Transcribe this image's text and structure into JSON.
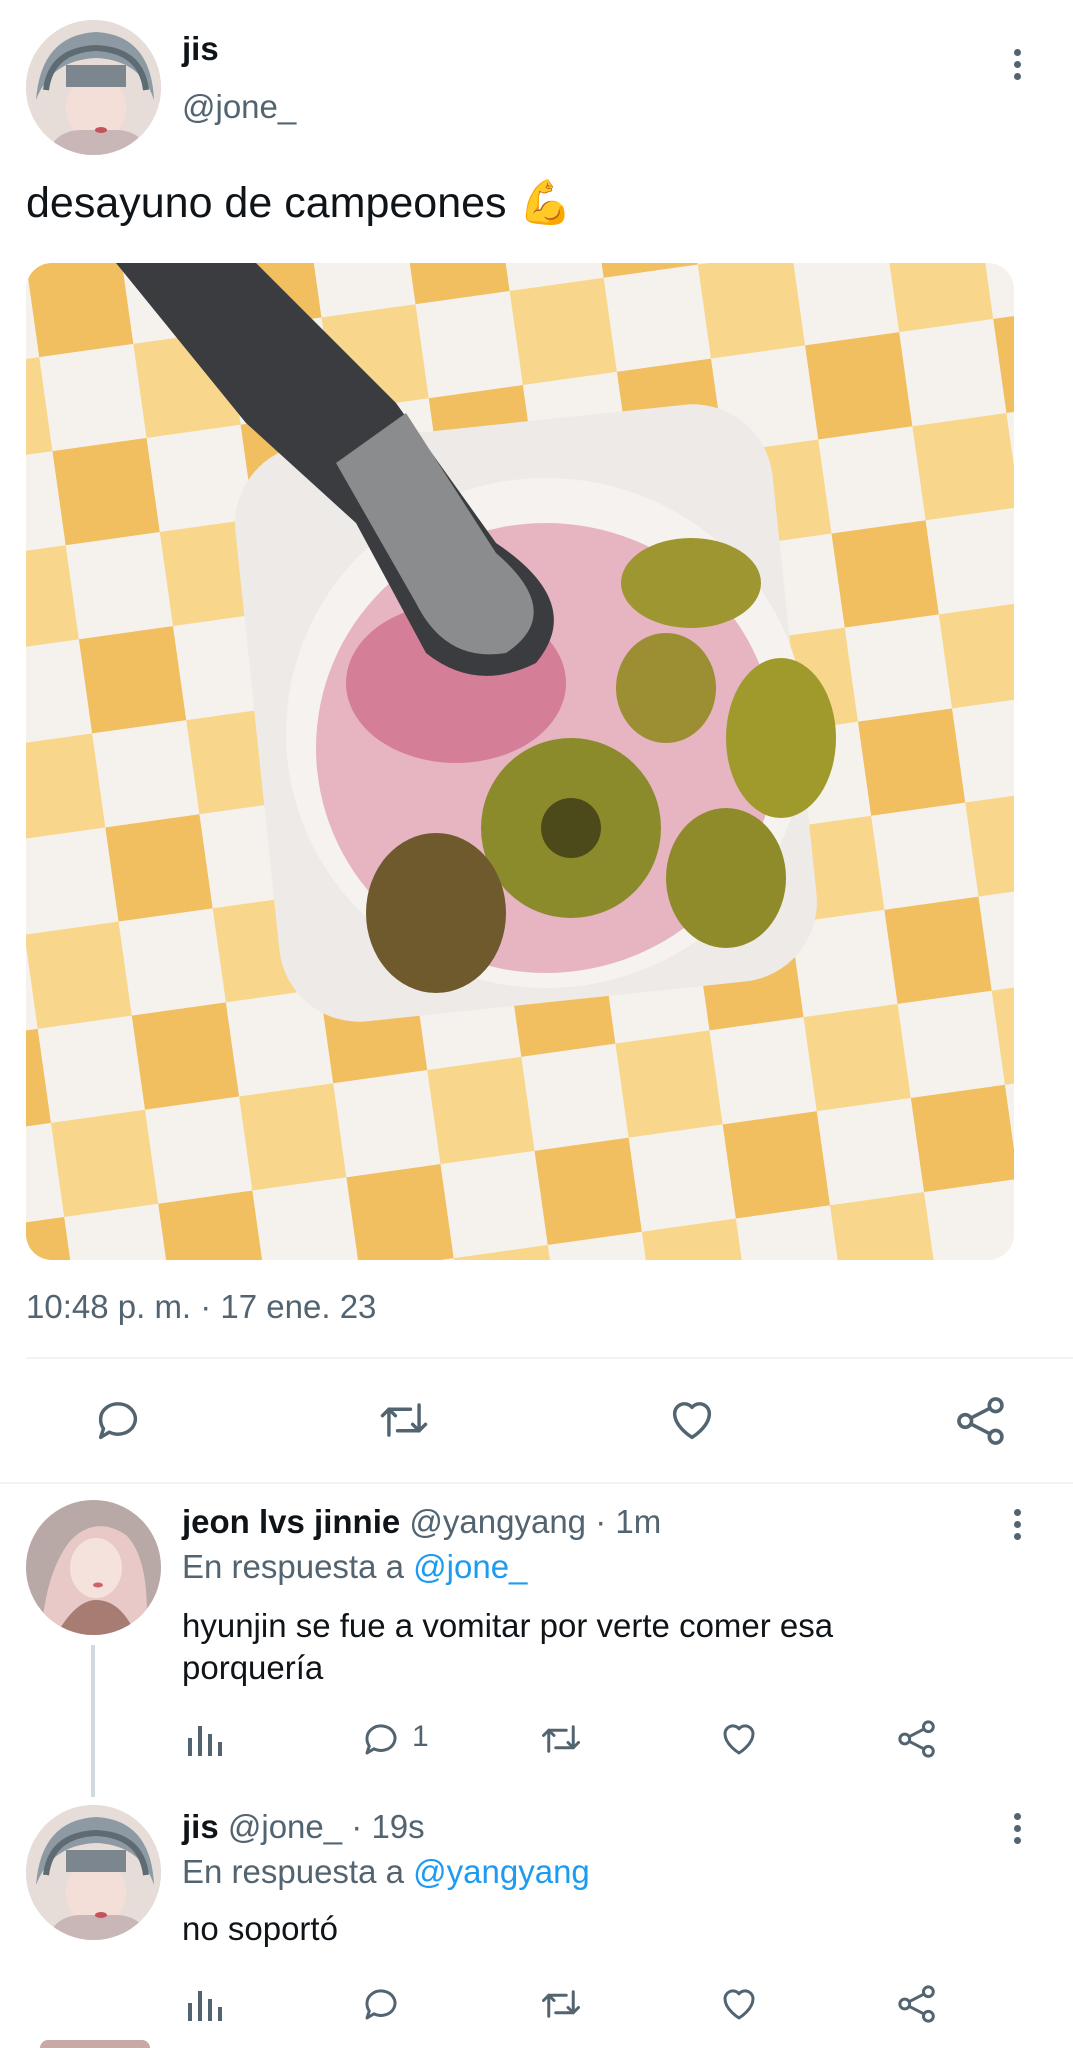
{
  "tweet": {
    "author_name": "jis",
    "author_handle": "@jone_",
    "text": "desayuno de campeones",
    "emoji": "💪",
    "timestamp": "10:48 p. m. · 17 ene. 23",
    "image_description_icon": "yogurt-photo",
    "actions": [
      "reply-icon",
      "retweet-icon",
      "like-icon",
      "share-icon"
    ]
  },
  "replies": [
    {
      "author_name": "jeon lvs jinnie",
      "author_handle": "@yangyang",
      "time": "· 1m",
      "reply_prefix": "En respuesta a",
      "reply_to": "@jone_",
      "text": "hyunjin se fue a vomitar por verte comer esa porquería",
      "reply_count": "1"
    },
    {
      "author_name": "jis",
      "author_handle": "@jone_",
      "time": "· 19s",
      "reply_prefix": "En respuesta a",
      "reply_to": "@yangyang",
      "text": "no soportó",
      "reply_count": ""
    }
  ],
  "colors": {
    "accent": "#1d9bf0",
    "muted": "#536471",
    "text": "#0f1419"
  }
}
